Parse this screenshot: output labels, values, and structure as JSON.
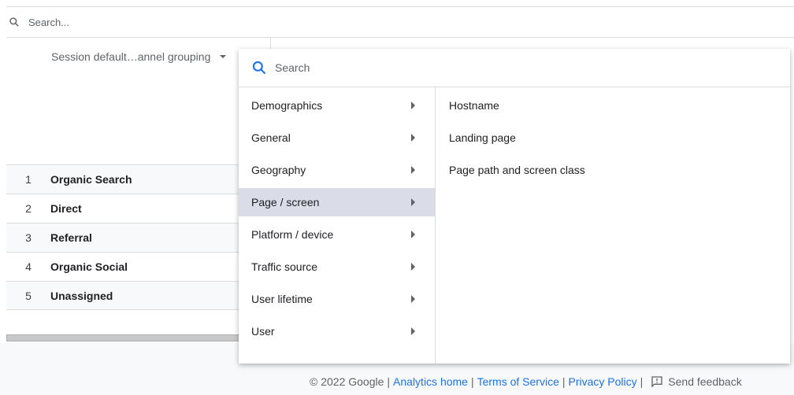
{
  "search": {
    "placeholder": "Search..."
  },
  "dimension": {
    "label": "Session default…annel grouping"
  },
  "rows": [
    {
      "n": "1",
      "label": "Organic Search"
    },
    {
      "n": "2",
      "label": "Direct"
    },
    {
      "n": "3",
      "label": "Referral"
    },
    {
      "n": "4",
      "label": "Organic Social"
    },
    {
      "n": "5",
      "label": "Unassigned"
    }
  ],
  "popup": {
    "search_placeholder": "Search",
    "categories": [
      "Demographics",
      "General",
      "Geography",
      "Page / screen",
      "Platform / device",
      "Traffic source",
      "User lifetime",
      "User"
    ],
    "selected": "Page / screen",
    "options": [
      "Hostname",
      "Landing page",
      "Page path and screen class"
    ]
  },
  "footer": {
    "copyright": "© 2022 Google",
    "sep": "|",
    "analytics_home": "Analytics home",
    "terms": "Terms of Service",
    "privacy": "Privacy Policy",
    "feedback": "Send feedback"
  },
  "colors": {
    "link": "#1a73e8",
    "accent": "#1a73e8",
    "selected_bg": "#dadce8"
  }
}
